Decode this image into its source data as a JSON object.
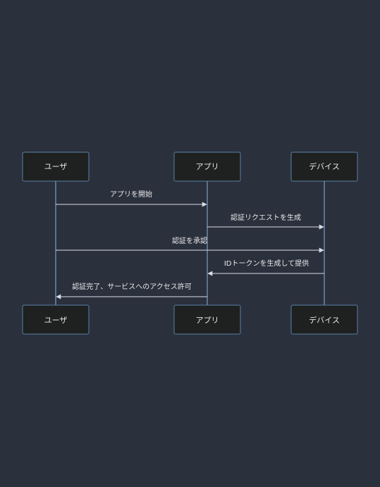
{
  "participants": [
    {
      "id": "user",
      "label": "ユーザ"
    },
    {
      "id": "app",
      "label": "アプリ"
    },
    {
      "id": "device",
      "label": "デバイス"
    }
  ],
  "messages": [
    {
      "from": "user",
      "to": "app",
      "label": "アプリを開始"
    },
    {
      "from": "app",
      "to": "device",
      "label": "認証リクエストを生成"
    },
    {
      "from": "user",
      "to": "device",
      "label": "認証を承認"
    },
    {
      "from": "device",
      "to": "app",
      "label": "IDトークンを生成して提供"
    },
    {
      "from": "app",
      "to": "user",
      "label": "認証完了、サービスへのアクセス許可"
    }
  ],
  "colors": {
    "background": "#2a303c",
    "actor_fill": "#1f2020",
    "actor_border": "#5a7fa8",
    "lifeline": "#8fb2e0",
    "message": "#d9dde3",
    "text": "#e8e8e8"
  }
}
